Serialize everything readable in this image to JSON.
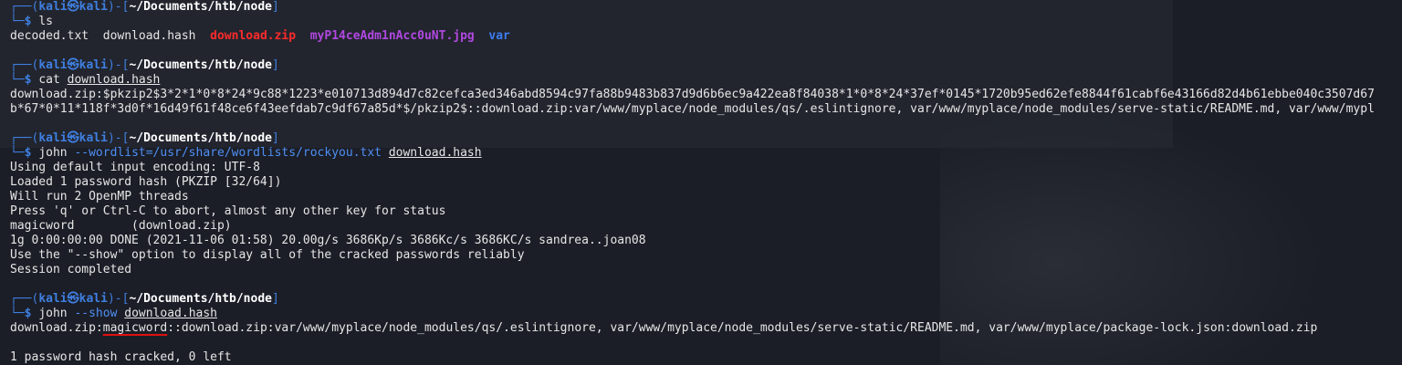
{
  "prompt": {
    "user": "kali",
    "at": "㉿",
    "host": "kali",
    "path": "~/Documents/htb/node",
    "top_left": "┌──(",
    "mid": ")-[",
    "close": "]",
    "bottom": "└─",
    "dollar": "$"
  },
  "block1": {
    "cmd": "ls",
    "files": [
      {
        "name": "decoded.txt",
        "kind": "plain"
      },
      {
        "name": "download.hash",
        "kind": "plain"
      },
      {
        "name": "download.zip",
        "kind": "archive"
      },
      {
        "name": "myP14ceAdm1nAcc0uNT.jpg",
        "kind": "image"
      },
      {
        "name": "var",
        "kind": "directory"
      }
    ]
  },
  "block2": {
    "cmd": "cat",
    "arg": "download.hash",
    "output1": "download.zip:$pkzip2$3*2*1*0*8*24*9c88*1223*e010713d894d7c82cefca3ed346abd8594c97fa88b9483b837d9d6b6ec9a422ea8f84038*1*0*8*24*37ef*0145*1720b95ed62efe8844f61cabf6e43166d82d4b61ebbe040c3507d67",
    "output2": "b*67*0*11*118f*3d0f*16d49f61f48ce6f43eefdab7c9df67a85d*$/pkzip2$::download.zip:var/www/myplace/node_modules/qs/.eslintignore, var/www/myplace/node_modules/serve-static/README.md, var/www/mypl"
  },
  "block3": {
    "cmd": "john",
    "flag": "--wordlist=/usr/share/wordlists/rockyou.txt",
    "arg": "download.hash",
    "output": [
      "Using default input encoding: UTF-8",
      "Loaded 1 password hash (PKZIP [32/64])",
      "Will run 2 OpenMP threads",
      "Press 'q' or Ctrl-C to abort, almost any other key for status",
      "magicword        (download.zip)",
      "1g 0:00:00:00 DONE (2021-11-06 01:58) 20.00g/s 3686Kp/s 3686Kc/s 3686KC/s sandrea..joan08",
      "Use the \"--show\" option to display all of the cracked passwords reliably",
      "Session completed"
    ]
  },
  "block4": {
    "cmd": "john",
    "flag": "--show",
    "arg": "download.hash",
    "out_prefix": "download.zip:",
    "out_pass": "magicword",
    "out_rest": "::download.zip:var/www/myplace/node_modules/qs/.eslintignore, var/www/myplace/node_modules/serve-static/README.md, var/www/myplace/package-lock.json:download.zip",
    "tail": "1 password hash cracked, 0 left"
  }
}
